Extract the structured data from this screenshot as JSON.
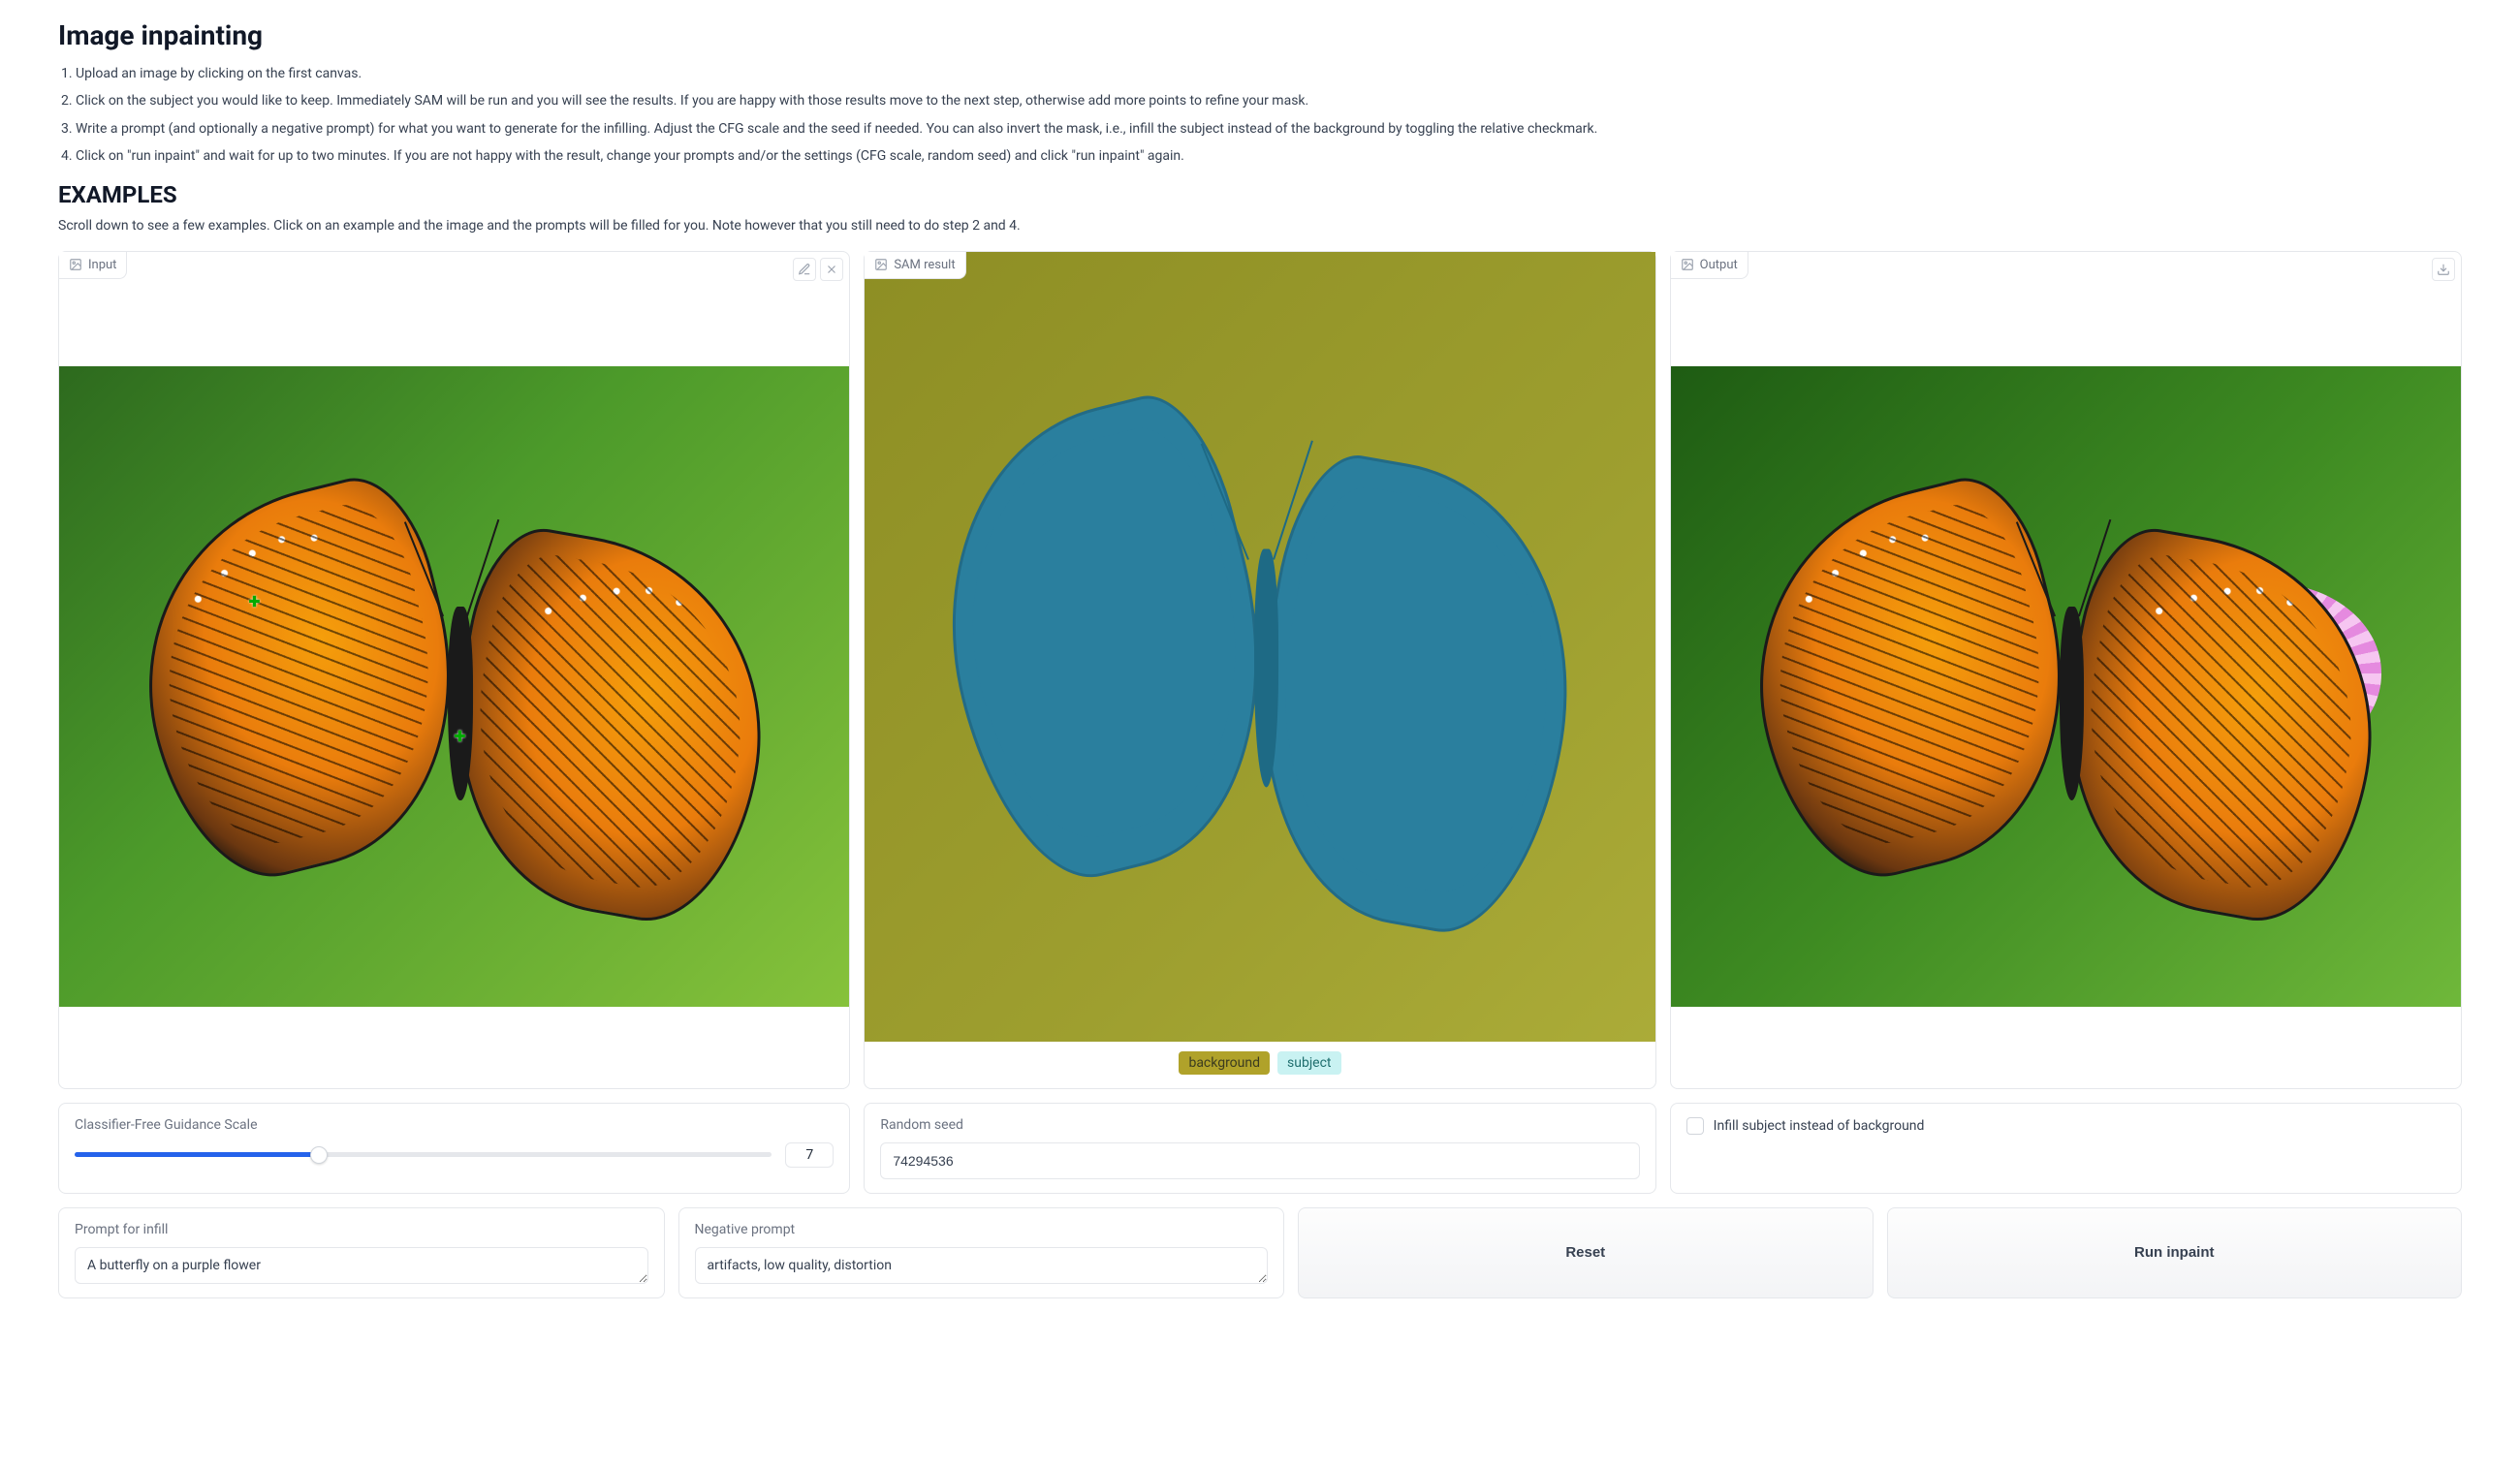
{
  "title": "Image inpainting",
  "steps": [
    "Upload an image by clicking on the first canvas.",
    "Click on the subject you would like to keep. Immediately SAM will be run and you will see the results. If you are happy with those results move to the next step, otherwise add more points to refine your mask.",
    "Write a prompt (and optionally a negative prompt) for what you want to generate for the infilling. Adjust the CFG scale and the seed if needed. You can also invert the mask, i.e., infill the subject instead of the background by toggling the relative checkmark.",
    "Click on \"run inpaint\" and wait for up to two minutes. If you are not happy with the result, change your prompts and/or the settings (CFG scale, random seed) and click \"run inpaint\" again."
  ],
  "examples_heading": "EXAMPLES",
  "examples_desc": "Scroll down to see a few examples. Click on an example and the image and the prompts will be filled for you. Note however that you still need to do step 2 and 4.",
  "panels": {
    "input": {
      "label": "Input"
    },
    "sam": {
      "label": "SAM result",
      "legend_bg": "background",
      "legend_sub": "subject"
    },
    "output": {
      "label": "Output"
    }
  },
  "cfg": {
    "label": "Classifier-Free Guidance Scale",
    "value": "7"
  },
  "seed": {
    "label": "Random seed",
    "value": "74294536"
  },
  "invert": {
    "label": "Infill subject instead of background"
  },
  "prompt": {
    "label": "Prompt for infill",
    "value": "A butterfly on a purple flower"
  },
  "neg": {
    "label": "Negative prompt",
    "value": "artifacts, low quality, distortion"
  },
  "buttons": {
    "reset": "Reset",
    "run": "Run inpaint"
  }
}
